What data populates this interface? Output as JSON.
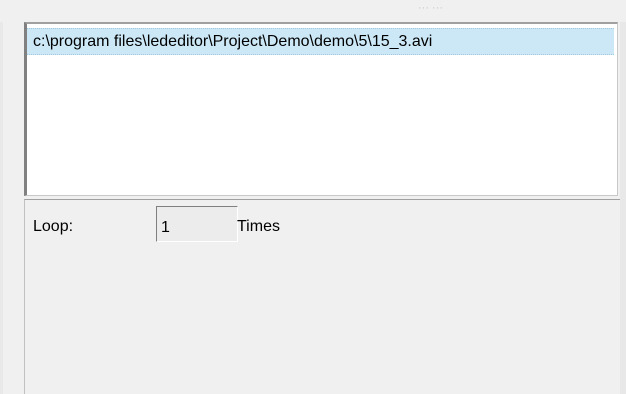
{
  "header": {
    "faint_text": "··· ···"
  },
  "file_list": {
    "items": [
      {
        "path": "c:\\program files\\lededitor\\Project\\Demo\\demo\\5\\15_3.avi",
        "selected": true
      }
    ]
  },
  "loop": {
    "label": "Loop:",
    "value": "1",
    "unit_label": "Times"
  },
  "colors": {
    "selection": "#cce8f7",
    "panel_bg": "#f0f0f0",
    "list_bg": "#ffffff"
  }
}
